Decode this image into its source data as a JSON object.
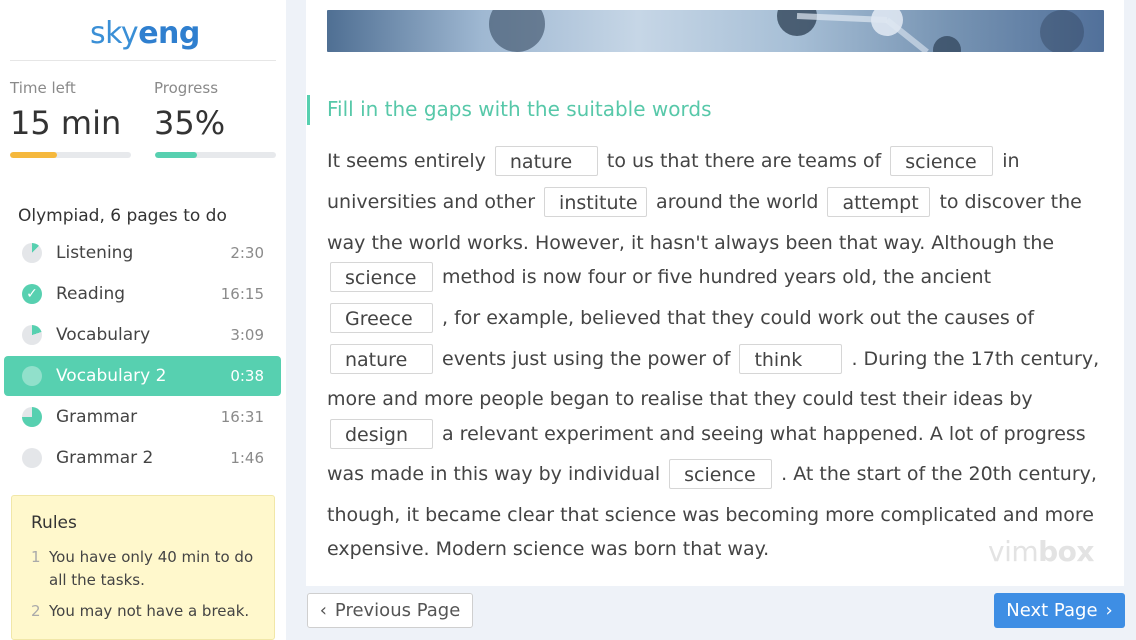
{
  "brand": {
    "logo_part1": "sky",
    "logo_part2": "eng"
  },
  "stats": {
    "time_left_label": "Time left",
    "time_left_value": "15 min",
    "progress_label": "Progress",
    "progress_value": "35%",
    "time_bar_fraction": 0.39,
    "progress_bar_fraction": 0.35
  },
  "colors": {
    "accent": "#57d0b0",
    "time_bar": "#f5b83d",
    "primary_button": "#3e8ee4",
    "rules_bg": "#fff8cc"
  },
  "sidebar": {
    "section_title": "Olympiad, 6 pages to do",
    "tasks": [
      {
        "name": "Listening",
        "time": "2:30",
        "icon": "pie-progress-icon",
        "completion": 0.12
      },
      {
        "name": "Reading",
        "time": "16:15",
        "icon": "check-circle-icon",
        "completion": 1
      },
      {
        "name": "Vocabulary",
        "time": "3:09",
        "icon": "pie-progress-icon",
        "completion": 0.2
      },
      {
        "name": "Vocabulary 2",
        "time": "0:38",
        "icon": "circle-icon",
        "completion": 0,
        "active": true
      },
      {
        "name": "Grammar",
        "time": "16:31",
        "icon": "pie-progress-icon",
        "completion": 0.75
      },
      {
        "name": "Grammar 2",
        "time": "1:46",
        "icon": "circle-icon",
        "completion": 0
      }
    ],
    "rules": {
      "title": "Rules",
      "items": [
        {
          "num": "1",
          "text": "You have only 40 min to do all the tasks."
        },
        {
          "num": "2",
          "text": "You may not have a break."
        }
      ]
    }
  },
  "main": {
    "instruction": "Fill in the gaps with the suitable words",
    "passage": {
      "l1a": "It seems entirely",
      "g1": "nature",
      "l1b": "to us that there are teams of",
      "g2": "science",
      "l1c": "in",
      "l2a": "universities and other",
      "g3": "institute",
      "l2b": "around the world",
      "g4": "attempt",
      "l2c": "to discover the",
      "l3a": "way the world works. However, it hasn't always been that way. Although the",
      "g5": "science",
      "l4a": "method is now four or five hundred years old, the ancient",
      "g6": "Greece",
      "l5a": ", for example, believed that they could work out the causes of",
      "g7": "nature",
      "l6a": "events just using the power of",
      "g8": "think",
      "l6b": ". During the 17th century,",
      "l7a": "more and more people began to realise that they could test their ideas by",
      "g9": "design",
      "l8a": "a relevant experiment and seeing what happened. A lot of progress",
      "l9a": "was made in this way by individual",
      "g10": "science",
      "l9b": ". At the start of the 20th century,",
      "l10a": "though, it became clear that science was becoming more complicated and more",
      "l11a": "expensive. Modern science was born that way."
    },
    "watermark_part1": "vim",
    "watermark_part2": "box"
  },
  "nav": {
    "prev_label": "Previous Page",
    "next_label": "Next Page"
  }
}
